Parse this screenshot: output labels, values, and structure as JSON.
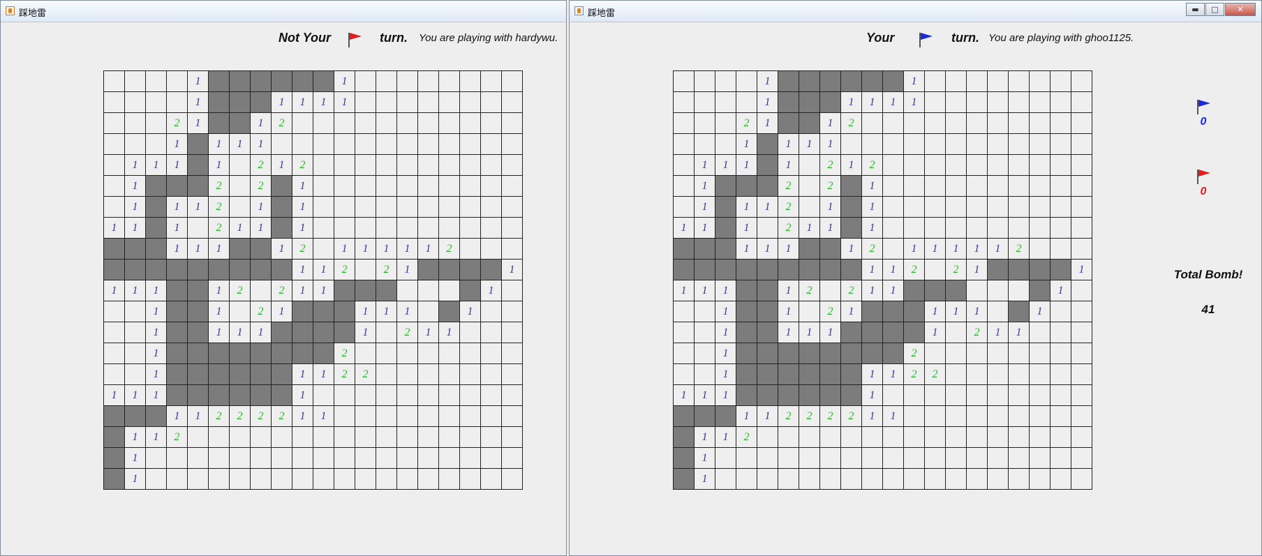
{
  "windows": [
    {
      "title": "踩地雷",
      "turn_prefix": "Not Your",
      "turn_suffix": "turn.",
      "turn_flag_color": "#e02020",
      "playing_with": "You are playing with hardywu."
    },
    {
      "title": "踩地雷",
      "turn_prefix": "Your",
      "turn_suffix": "turn.",
      "turn_flag_color": "#1a2ad6",
      "playing_with": "You are playing with ghoo1125.",
      "controls": {
        "minimize": "▬",
        "maximize": "□",
        "close": "✕"
      }
    }
  ],
  "scores": {
    "blue": {
      "flag_color": "#1a2ad6",
      "count": "0"
    },
    "red": {
      "flag_color": "#e02020",
      "count": "0"
    }
  },
  "total_bomb_label": "Total Bomb!",
  "total_bomb": "41",
  "board_rows": [
    "....1######1........",
    "....1###1111........",
    "...21##12...........",
    "...1#111............",
    ".111#1.212..........",
    ".1###2.2#1..........",
    ".1#112.1#1..........",
    "11#1.211#1..........",
    "###111##12.111112...",
    "#########112.21####1",
    "111##12.211###...#1.",
    "..1##1.21###111.#1..",
    "..1##111####1.211...",
    "..1########2........",
    "..1######1122.......",
    "111######1..........",
    "###11222211.........",
    "#112................",
    "#1..................",
    "#1.................."
  ],
  "colors": {
    "unopened": "#7c7c7c",
    "opened": "#efefef",
    "one": "#3b3b9a",
    "two": "#28b828"
  }
}
